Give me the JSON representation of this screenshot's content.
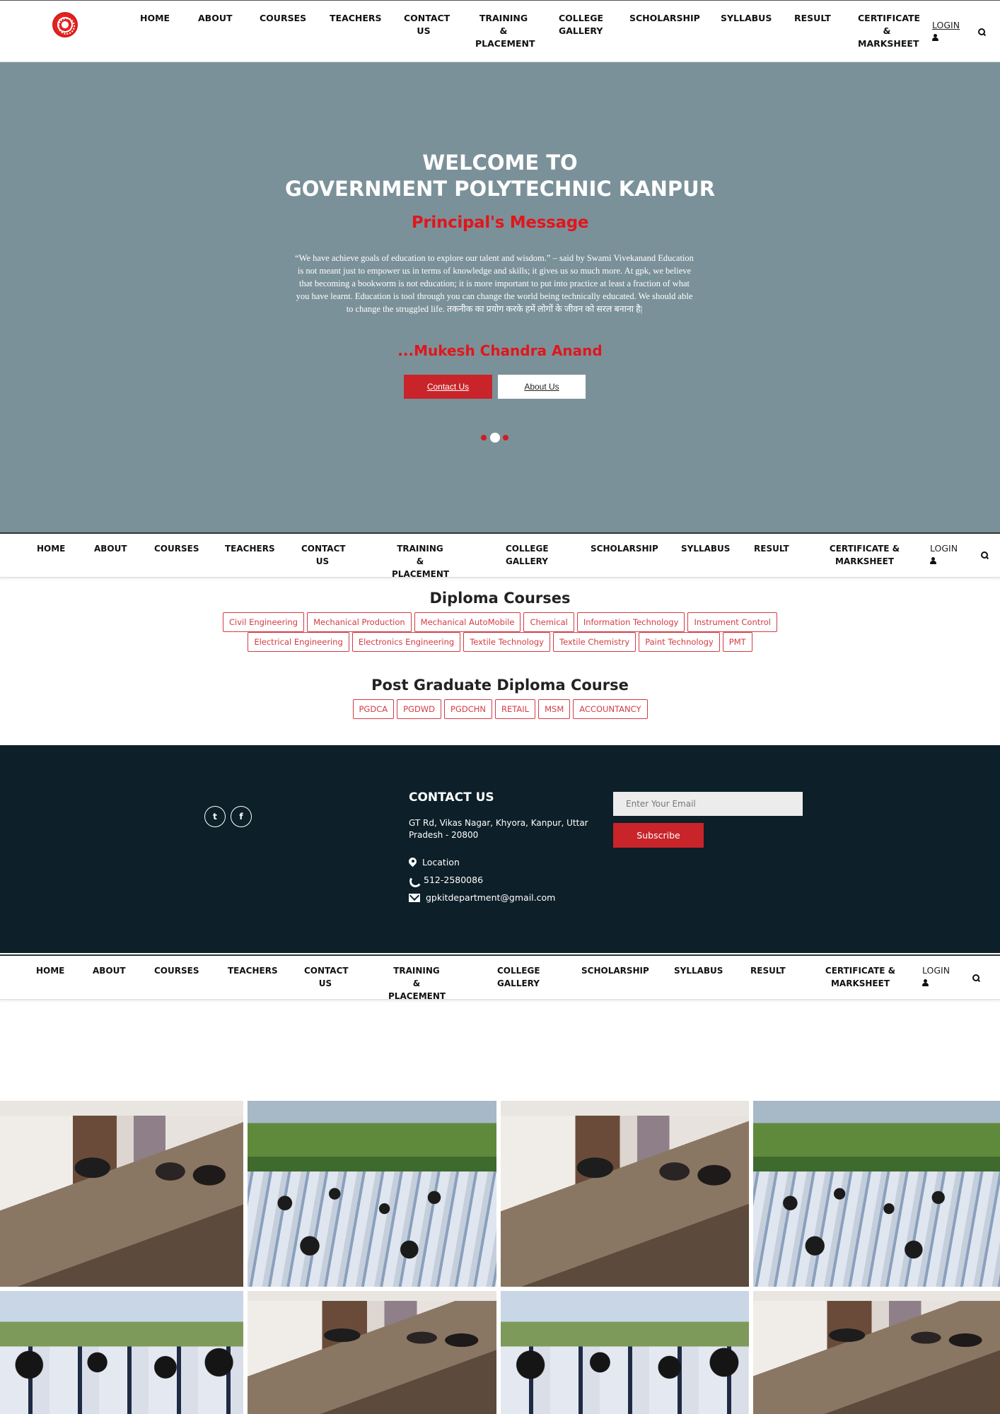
{
  "nav": {
    "items": [
      "HOME",
      "ABOUT",
      "COURSES",
      "TEACHERS",
      "CONTACT US",
      "TRAINING & PLACEMENT",
      "COLLEGE GALLERY",
      "SCHOLARSHIP",
      "SYLLABUS",
      "RESULT",
      "CERTIFICATE & MARKSHEET"
    ],
    "login": "LOGIN"
  },
  "hero": {
    "title_line1": "WELCOME TO",
    "title_line2": "GOVERNMENT POLYTECHNIC KANPUR",
    "principal_heading": "Principal's Message",
    "message": "“We have achieve goals of education to explore our talent and wisdom.” – said by Swami Vivekanand Education is not meant just to empower us in terms of knowledge and skills; it gives us so much more. At gpk, we believe that becoming a bookworm is not education; it is more important to put into practice at least a fraction of what you have learnt. Education is tool through you can change the world being technically educated. We should able to change the struggled life. तकनीक का प्रयोग करके हमें लोगों के जीवन को सरल बनाना है|",
    "signature": "...Mukesh Chandra Anand",
    "contact_button": "Contact Us",
    "about_button": "About Us",
    "slide_count": 3,
    "active_slide": 2
  },
  "courses": {
    "diploma_title": "Diploma Courses",
    "diploma_row1": [
      "Civil Engineering",
      "Mechanical Production",
      "Mechanical AutoMobile",
      "Chemical",
      "Information Technology",
      "Instrument Control"
    ],
    "diploma_row2": [
      "Electrical Engineering",
      "Electronics Engineering",
      "Textile Technology",
      "Textile Chemistry",
      "Paint Technology",
      "PMT"
    ],
    "pg_title": "Post Graduate Diploma Course",
    "pg_items": [
      "PGDCA",
      "PGDWD",
      "PGDCHN",
      "RETAIL",
      "MSM",
      "ACCOUNTANCY"
    ]
  },
  "footer": {
    "social": [
      "twitter-icon",
      "facebook-icon"
    ],
    "social_glyphs": [
      "t",
      "f"
    ],
    "contact_heading": "CONTACT US",
    "address": "GT Rd, Vikas Nagar, Khyora, Kanpur, Uttar Pradesh - 20800",
    "location": "Location",
    "phone": "512-2580086",
    "email": "gpkitdepartment@gmail.com",
    "email_placeholder": "Enter Your Email",
    "subscribe": "Subscribe"
  },
  "gallery": {
    "photos": [
      "office-meeting-photo",
      "students-assembly-photo",
      "office-meeting-photo",
      "students-assembly-photo",
      "students-group-photo",
      "office-meeting-photo",
      "students-group-photo",
      "office-meeting-photo"
    ]
  },
  "colors": {
    "hero_bg": "#7b9199",
    "accent_red": "#d11b22",
    "footer_bg": "#0d1f28"
  }
}
